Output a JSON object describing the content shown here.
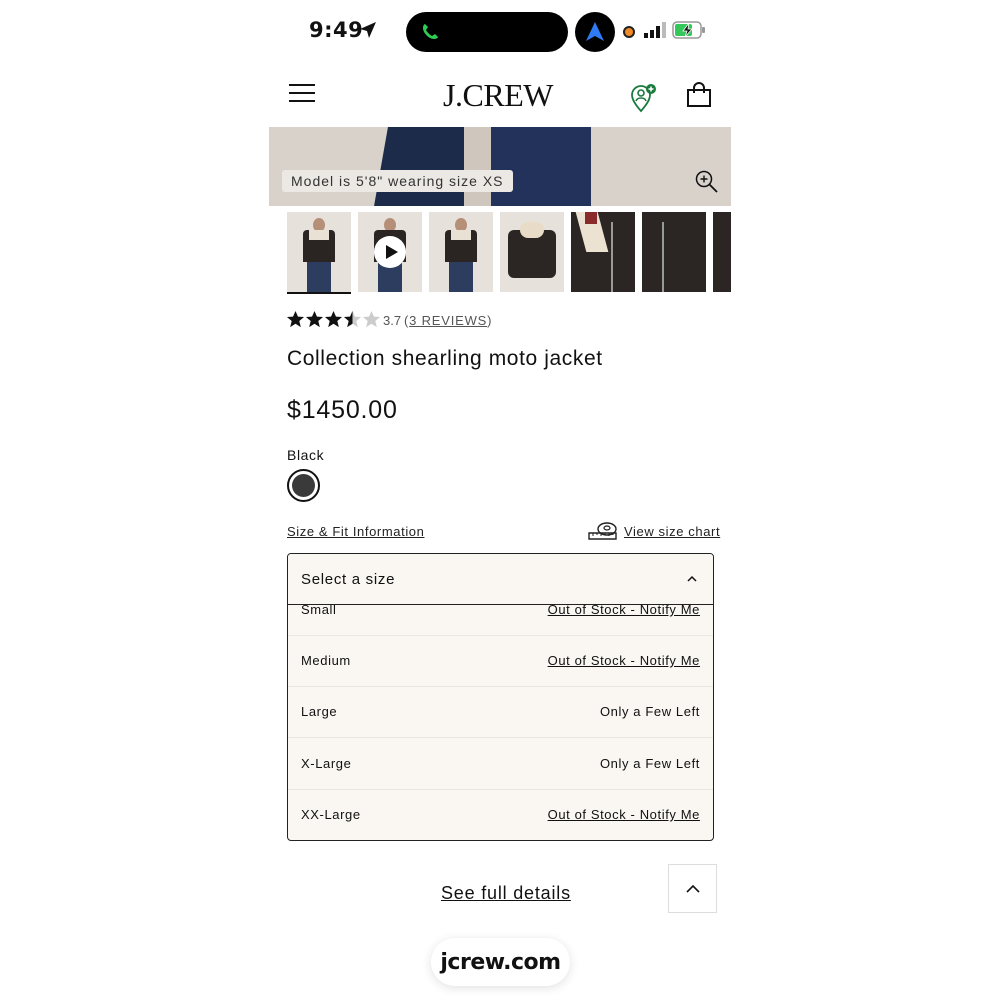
{
  "status_bar": {
    "time": "9:49"
  },
  "header": {
    "logo": "J.CREW"
  },
  "hero": {
    "model_note": "Model is 5'8\" wearing size XS"
  },
  "product": {
    "rating_value": "3.7",
    "rating_stars": 3.7,
    "reviews_open": "(",
    "reviews_link": "3 REVIEWS",
    "reviews_close": ")",
    "title": "Collection shearling moto jacket",
    "price": "$1450.00",
    "color_name": "Black",
    "swatch_color": "#3a3a3a"
  },
  "links": {
    "size_fit": "Size & Fit Information",
    "size_chart": "View size chart"
  },
  "size_select": {
    "placeholder": "Select a size",
    "options": [
      {
        "label": "Small",
        "availability": "Out of Stock - Notify Me"
      },
      {
        "label": "Medium",
        "availability": "Out of Stock - Notify Me"
      },
      {
        "label": "Large",
        "availability": "Only a Few Left"
      },
      {
        "label": "X-Large",
        "availability": "Only a Few Left"
      },
      {
        "label": "XX-Large",
        "availability": "Out of Stock - Notify Me"
      }
    ]
  },
  "footer": {
    "see_full_details": "See full details"
  },
  "browser": {
    "url": "jcrew.com"
  },
  "colors": {
    "accent_green": "#1a7a3e",
    "phone_green": "#2ecc52",
    "nav_blue": "#2f7bf5"
  }
}
